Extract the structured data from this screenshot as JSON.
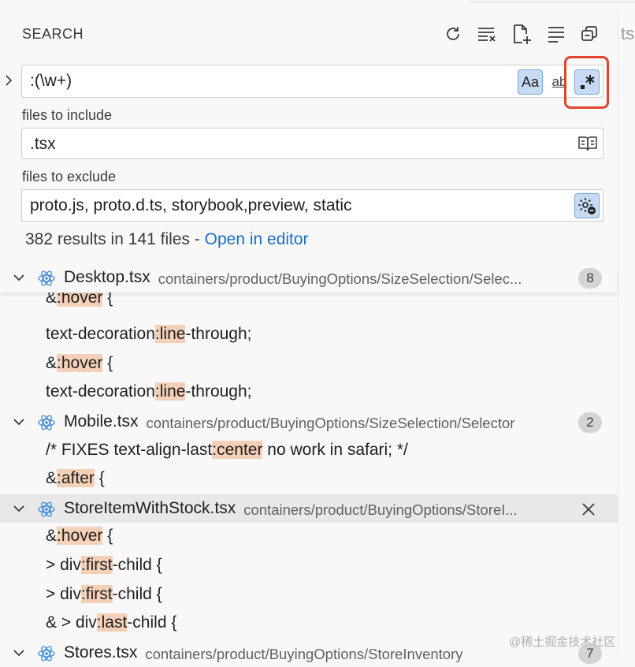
{
  "header": {
    "title": "SEARCH",
    "icons": [
      "refresh-icon",
      "clear-results-icon",
      "new-search-editor-icon",
      "view-as-tree-icon",
      "collapse-all-icon"
    ]
  },
  "background_tab_fragment": "ts",
  "search": {
    "value": ":(\\w+)",
    "match_case_label": "Aa",
    "whole_word_label": "ab",
    "regex_label": ".*",
    "regex_enabled": true,
    "highlight_color": "#e0432f"
  },
  "include": {
    "label": "files to include",
    "value": ".tsx"
  },
  "exclude": {
    "label": "files to exclude",
    "value": "proto.js, proto.d.ts, storybook,preview, static"
  },
  "summary": {
    "text": "382 results in 141 files - ",
    "link": "Open in editor"
  },
  "results": [
    {
      "kind": "file",
      "name": "Desktop.tsx",
      "path": "containers/product/BuyingOptions/SizeSelection/Selec...",
      "count": "8",
      "sticky": true
    },
    {
      "kind": "match",
      "pre": "&",
      "hl": ":hover",
      "post": " {",
      "clipped": true
    },
    {
      "kind": "match",
      "pre": "text-decoration",
      "hl": ":line",
      "post": "-through;"
    },
    {
      "kind": "match",
      "pre": "&",
      "hl": ":hover",
      "post": " {"
    },
    {
      "kind": "match",
      "pre": "text-decoration",
      "hl": ":line",
      "post": "-through;"
    },
    {
      "kind": "file",
      "name": "Mobile.tsx",
      "path": "containers/product/BuyingOptions/SizeSelection/Selector",
      "count": "2"
    },
    {
      "kind": "match",
      "pre": "/* FIXES text-align-last",
      "hl": ":center",
      "post": " no work in safari; */"
    },
    {
      "kind": "match",
      "pre": "&",
      "hl": ":after",
      "post": " {"
    },
    {
      "kind": "file",
      "name": "StoreItemWithStock.tsx",
      "path": "containers/product/BuyingOptions/StoreI...",
      "hovered": true,
      "dismiss": true
    },
    {
      "kind": "match",
      "pre": "&",
      "hl": ":hover",
      "post": " {"
    },
    {
      "kind": "match",
      "pre": "> div",
      "hl": ":first",
      "post": "-child {"
    },
    {
      "kind": "match",
      "pre": "> div",
      "hl": ":first",
      "post": "-child {"
    },
    {
      "kind": "match",
      "pre": "& > div",
      "hl": ":last",
      "post": "-child {"
    },
    {
      "kind": "file",
      "name": "Stores.tsx",
      "path": "containers/product/BuyingOptions/StoreInventory",
      "count": "7"
    }
  ],
  "watermark": "@稀土掘金技术社区",
  "colors": {
    "accent_link": "#1a6ec6",
    "match_highlight": "#f3d0b7",
    "toggle_active": "#c6dbf3",
    "react_icon": "#3f8bd8"
  }
}
